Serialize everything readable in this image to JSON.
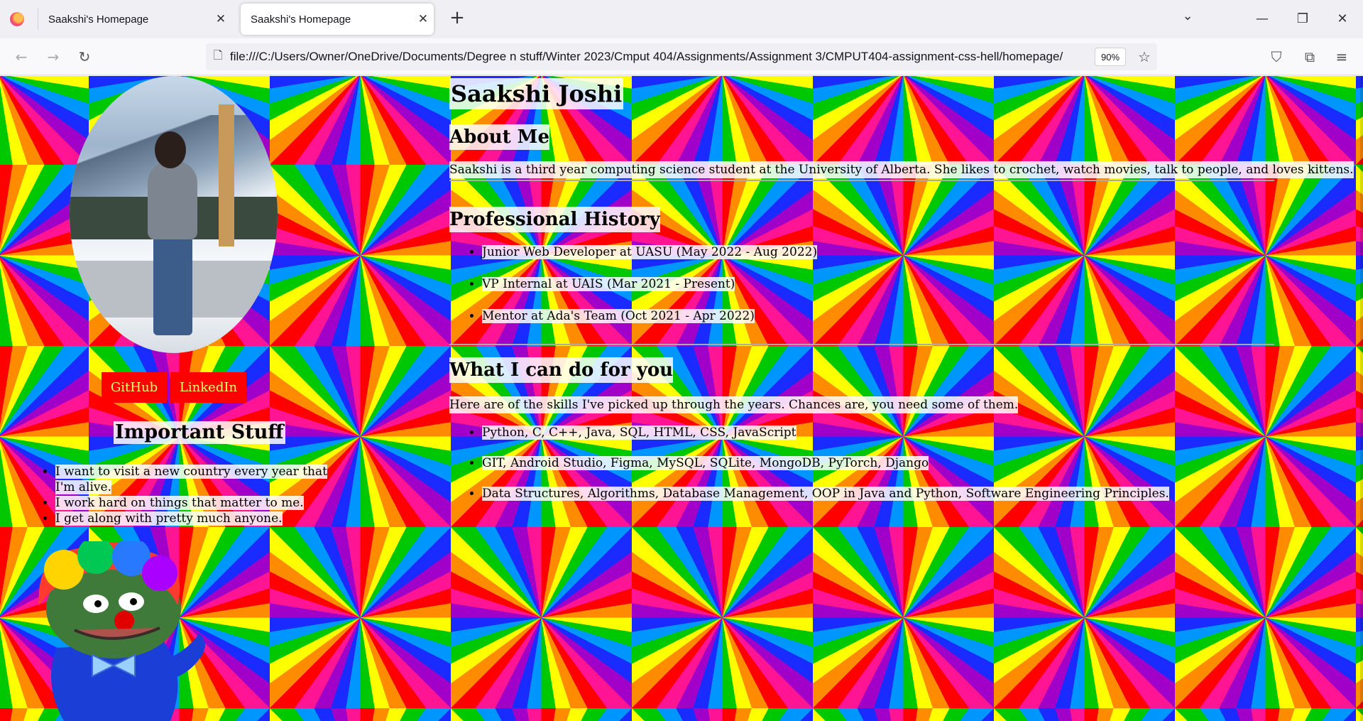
{
  "browser": {
    "tabs": [
      {
        "title": "Saakshi's Homepage",
        "active": false
      },
      {
        "title": "Saakshi's Homepage",
        "active": true
      }
    ],
    "url": "file:///C:/Users/Owner/OneDrive/Documents/Degree n stuff/Winter 2023/Cmput 404/Assignments/Assignment 3/CMPUT404-assignment-css-hell/homepage/",
    "zoom": "90%",
    "icons": [
      "firefox-icon",
      "close-icon",
      "plus-icon",
      "chevron-down-icon",
      "minimize-icon",
      "restore-icon",
      "back-icon",
      "forward-icon",
      "reload-icon",
      "page-icon",
      "star-icon",
      "pocket-icon",
      "extensions-icon",
      "menu-icon"
    ]
  },
  "page": {
    "name": "Saakshi Joshi",
    "about": {
      "heading": "About Me",
      "text": "Saakshi is a third year computing science student at the University of Alberta. She likes to crochet, watch movies, talk to people, and loves kittens."
    },
    "history": {
      "heading": "Professional History",
      "items": [
        "Junior Web Developer at UASU (May 2022 - Aug 2022)",
        "VP Internal at UAIS (Mar 2021 - Present)",
        "Mentor at Ada's Team (Oct 2021 - Apr 2022)"
      ]
    },
    "skills": {
      "heading": "What I can do for you",
      "intro": "Here are of the skills I've picked up through the years. Chances are, you need some of them.",
      "items": [
        "Python, C, C++, Java, SQL, HTML, CSS, JavaScript",
        "GIT, Android Studio, Figma, MySQL, SQLite, MongoDB, PyTorch, Django",
        "Data Structures, Algorithms, Database Management, OOP in Java and Python, Software Engineering Principles."
      ]
    },
    "links": {
      "github": "GitHub",
      "linkedin": "LinkedIn"
    },
    "important": {
      "heading": "Important Stuff",
      "items": [
        "I want to visit a new country every year that I'm alive.",
        "I work hard on things that matter to me.",
        "I get along with pretty much anyone."
      ]
    },
    "colors": {
      "button_bg": "#ff0000",
      "button_text": "#ffff66",
      "highlight_bg": "#ffffff"
    }
  }
}
